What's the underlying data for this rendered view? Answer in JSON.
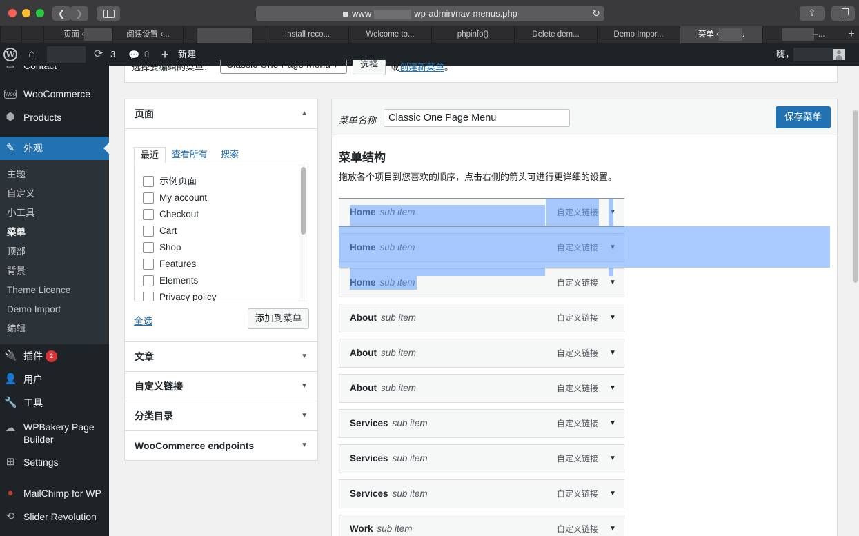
{
  "browser": {
    "url_prefix": "www",
    "url_suffix": "wp-admin/nav-menus.php",
    "tabs": [
      {
        "label": "页面 ‹"
      },
      {
        "label": "阅读设置 ‹..."
      },
      {
        "label": ""
      },
      {
        "label": "Install reco..."
      },
      {
        "label": "Welcome to..."
      },
      {
        "label": "phpinfo()"
      },
      {
        "label": "Delete dem..."
      },
      {
        "label": "Demo Impor..."
      },
      {
        "label": "菜单 ‹"
      },
      {
        "label": "–..."
      }
    ],
    "new_tab": "+"
  },
  "adminbar": {
    "updates_count": "3",
    "comments_count": "0",
    "new_label": "新建",
    "howdy": "嗨，"
  },
  "sidebar": {
    "items": [
      {
        "label": "Contact",
        "icon": "contact-icon"
      },
      {
        "label": "WooCommerce",
        "icon": "woo-icon"
      },
      {
        "label": "Products",
        "icon": "box-icon"
      },
      {
        "label": "外观",
        "icon": "brush-icon"
      },
      {
        "label": "插件",
        "icon": "plugin-icon",
        "badge": "2"
      },
      {
        "label": "用户",
        "icon": "user-icon"
      },
      {
        "label": "工具",
        "icon": "wrench-icon"
      },
      {
        "label": "WPBakery Page Builder",
        "icon": "cloud-icon"
      },
      {
        "label": "Settings",
        "icon": "settings-icon"
      },
      {
        "label": "MailChimp for WP",
        "icon": "mailchimp-icon"
      },
      {
        "label": "Slider Revolution",
        "icon": "refresh-icon"
      }
    ],
    "submenu": [
      "主题",
      "自定义",
      "小工具",
      "菜单",
      "顶部",
      "背景",
      "Theme Licence",
      "Demo Import",
      "编辑"
    ]
  },
  "select_bar": {
    "label": "选择要编辑的菜单：",
    "selected": "Classic One Page Menu",
    "button": "选择",
    "or": "或",
    "create_link": "创建新菜单",
    "end": "。"
  },
  "pages_box": {
    "title": "页面",
    "tabs": [
      "最近",
      "查看所有",
      "搜索"
    ],
    "pages": [
      "示例页面",
      "My account",
      "Checkout",
      "Cart",
      "Shop",
      "Features",
      "Elements",
      "Privacy policy"
    ],
    "select_all": "全选",
    "add_button": "添加到菜单"
  },
  "other_boxes": [
    "文章",
    "自定义链接",
    "分类目录",
    "WooCommerce endpoints"
  ],
  "menu_editor": {
    "name_label": "菜单名称",
    "name_value": "Classic One Page Menu",
    "save_button": "保存菜单",
    "structure_title": "菜单结构",
    "structure_desc": "拖放各个项目到您喜欢的顺序，点击右侧的箭头可进行更详细的设置。",
    "items": [
      {
        "title": "Home",
        "sub": "sub item",
        "type": "自定义链接"
      },
      {
        "title": "Home",
        "sub": "sub item",
        "type": "自定义链接"
      },
      {
        "title": "Home",
        "sub": "sub item",
        "type": "自定义链接"
      },
      {
        "title": "About",
        "sub": "sub item",
        "type": "自定义链接"
      },
      {
        "title": "About",
        "sub": "sub item",
        "type": "自定义链接"
      },
      {
        "title": "About",
        "sub": "sub item",
        "type": "自定义链接"
      },
      {
        "title": "Services",
        "sub": "sub item",
        "type": "自定义链接"
      },
      {
        "title": "Services",
        "sub": "sub item",
        "type": "自定义链接"
      },
      {
        "title": "Services",
        "sub": "sub item",
        "type": "自定义链接"
      },
      {
        "title": "Work",
        "sub": "sub item",
        "type": "自定义链接"
      }
    ]
  },
  "colors": {
    "wp_dark": "#1d2327",
    "wp_blue": "#2271b1",
    "selection": "#64a0ff"
  }
}
